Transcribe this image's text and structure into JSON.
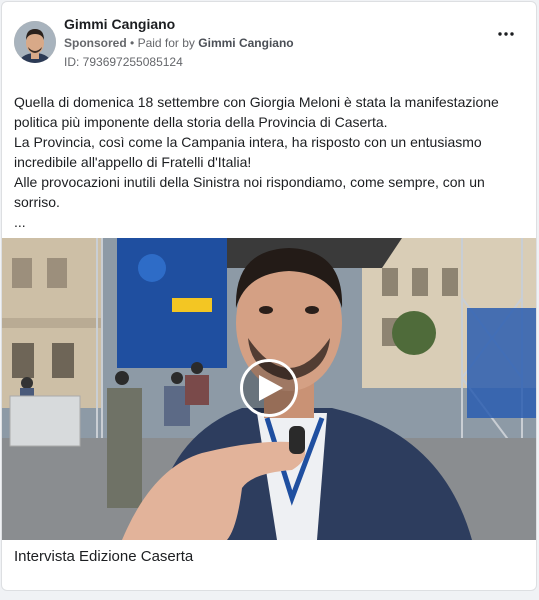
{
  "post": {
    "author_name": "Gimmi Cangiano",
    "sponsored_label": "Sponsored",
    "separator": "•",
    "paid_for_prefix": "Paid for by",
    "paid_for_name": "Gimmi Cangiano",
    "ad_id": "ID: 793697255085124",
    "more_icon": "more-horizontal-icon",
    "text_lines": [
      "Quella di domenica 18 settembre con Giorgia Meloni è stata la manifestazione politica più imponente della storia della Provincia di Caserta.",
      "La Provincia, così come la Campania intera, ha risposto con un entusiasmo incredibile all'appello di Fratelli d'Italia!",
      "Alle provocazioni inutili della Sinistra noi rispondiamo, come sempre, con un sorriso.",
      "..."
    ],
    "video": {
      "play_icon": "play-icon"
    },
    "caption": "Intervista Edizione Caserta"
  },
  "colors": {
    "text_primary": "#1c1e21",
    "text_secondary": "#65676b",
    "card_border": "#dddfe2",
    "page_bg": "#f0f2f5",
    "banner_blue": "#1f4fa0"
  }
}
